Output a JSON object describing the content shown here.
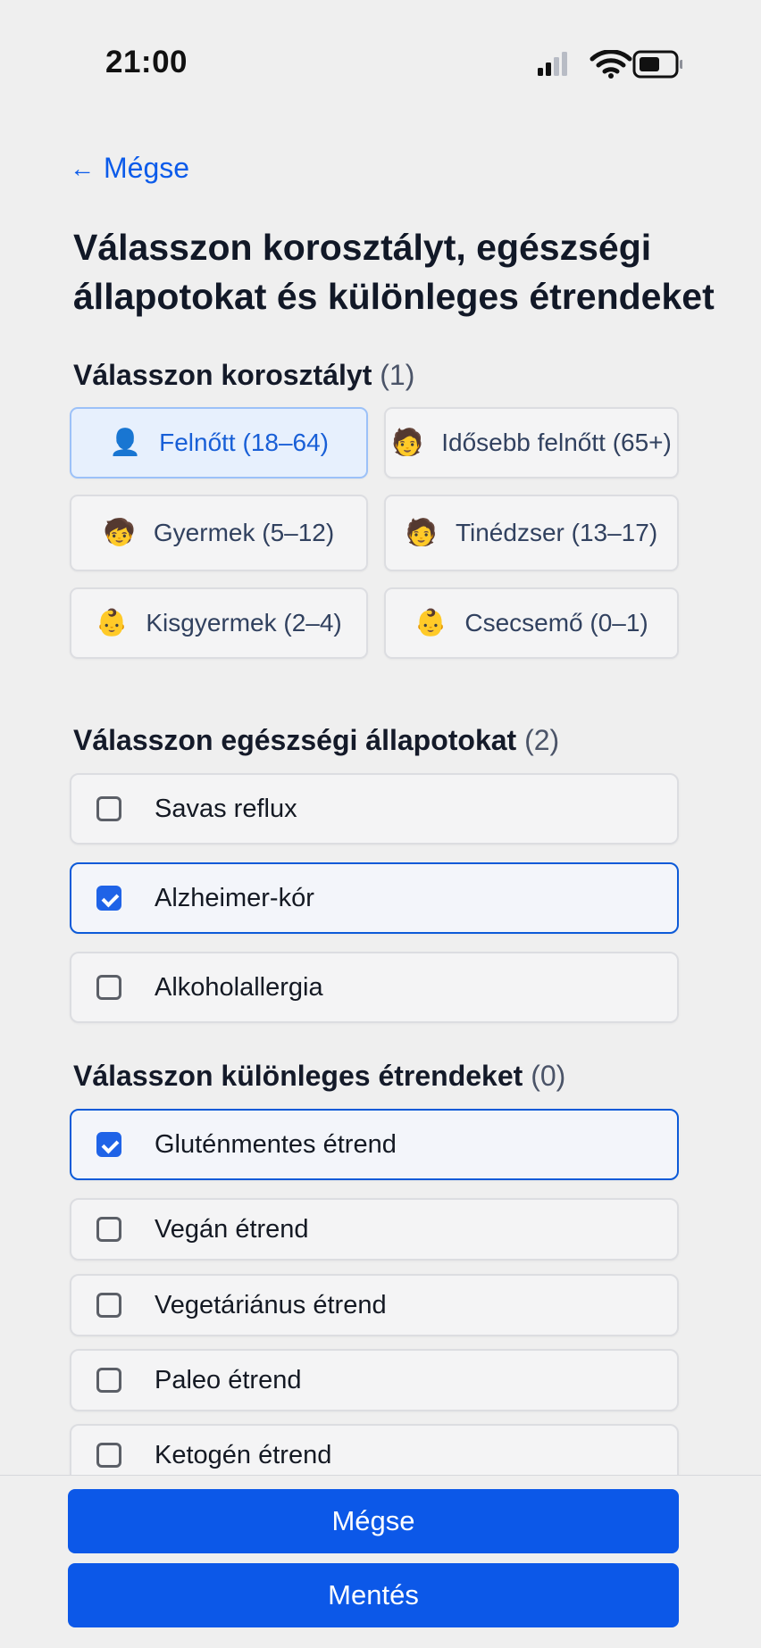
{
  "status_bar": {
    "time": "21:00"
  },
  "nav": {
    "back_label": "Mégse"
  },
  "title": "Válasszon korosztályt, egészségi állapotokat és különleges étrendeket",
  "age_section": {
    "heading": "Válasszon korosztályt",
    "count": "(1)",
    "options": [
      {
        "label": "Felnőtt (18–64)",
        "icon": "👤",
        "selected": true
      },
      {
        "label": "Idősebb felnőtt (65+)",
        "icon": "🧑",
        "selected": false
      },
      {
        "label": "Gyermek (5–12)",
        "icon": "🧒",
        "selected": false
      },
      {
        "label": "Tinédzser (13–17)",
        "icon": "🧑",
        "selected": false
      },
      {
        "label": "Kisgyermek (2–4)",
        "icon": "👶",
        "selected": false
      },
      {
        "label": "Csecsemő (0–1)",
        "icon": "👶",
        "selected": false
      }
    ]
  },
  "health_section": {
    "heading": "Válasszon egészségi állapotokat",
    "count": "(2)",
    "options": [
      {
        "label": "Savas reflux",
        "checked": false
      },
      {
        "label": "Alzheimer-kór",
        "checked": true
      },
      {
        "label": "Alkoholallergia",
        "checked": false
      }
    ]
  },
  "diet_section": {
    "heading": "Válasszon különleges étrendeket",
    "count": "(0)",
    "options": [
      {
        "label": "Gluténmentes étrend",
        "checked": true
      },
      {
        "label": "Vegán étrend",
        "checked": false
      },
      {
        "label": "Vegetáriánus étrend",
        "checked": false
      },
      {
        "label": "Paleo étrend",
        "checked": false
      },
      {
        "label": "Ketogén étrend",
        "checked": false
      }
    ]
  },
  "actions": {
    "cancel_label": "Mégse",
    "save_label": "Mentés"
  },
  "colors": {
    "accent": "#0c58e8",
    "selected_card_bg": "#e7f0fd",
    "background": "#efefef"
  }
}
